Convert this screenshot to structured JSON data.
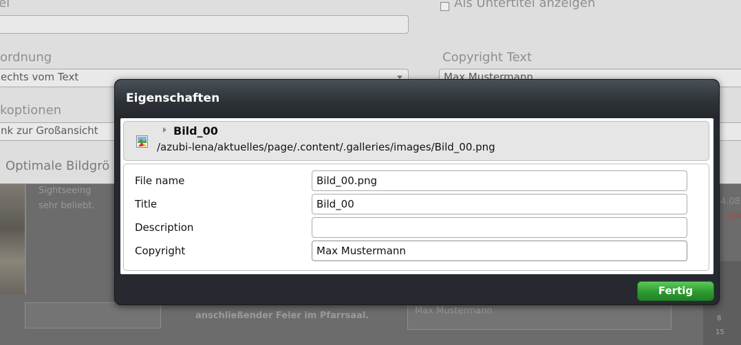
{
  "background": {
    "top_label_partial": "el",
    "subtitle_checkbox_label": "Als Untertitel anzeigen",
    "arrangement_label": "ordnung",
    "arrangement_value": "echts vom Text",
    "copyright_label": "Copyright Text",
    "copyright_value": "Max Mustermann",
    "link_options_label": "kopti­onen",
    "link_options_value": "nk zur Großansicht",
    "optimal_size_label": "Optimale Bildgrö",
    "content_text_1": "Sightseeing",
    "content_text_2": "sehr beliebt.",
    "content_text_3": "anschließender Feier im Pfarrsaal.",
    "card_text": "Max Mustermann",
    "right_partial_1": "4.08",
    "right_partial_2": "usbi",
    "calendar_numbers": [
      "8",
      "15"
    ]
  },
  "dialog": {
    "title": "Eigenschaften",
    "file": {
      "name": "Bild_00",
      "path": "/azubi-lena/aktuelles/page/.content/.galleries/images/Bild_00.png"
    },
    "fields": [
      {
        "label": "File name",
        "value": "Bild_00.png"
      },
      {
        "label": "Title",
        "value": "Bild_00"
      },
      {
        "label": "Description",
        "value": ""
      },
      {
        "label": "Copyright",
        "value": "Max Mustermann"
      }
    ],
    "done_label": "Fertig"
  }
}
